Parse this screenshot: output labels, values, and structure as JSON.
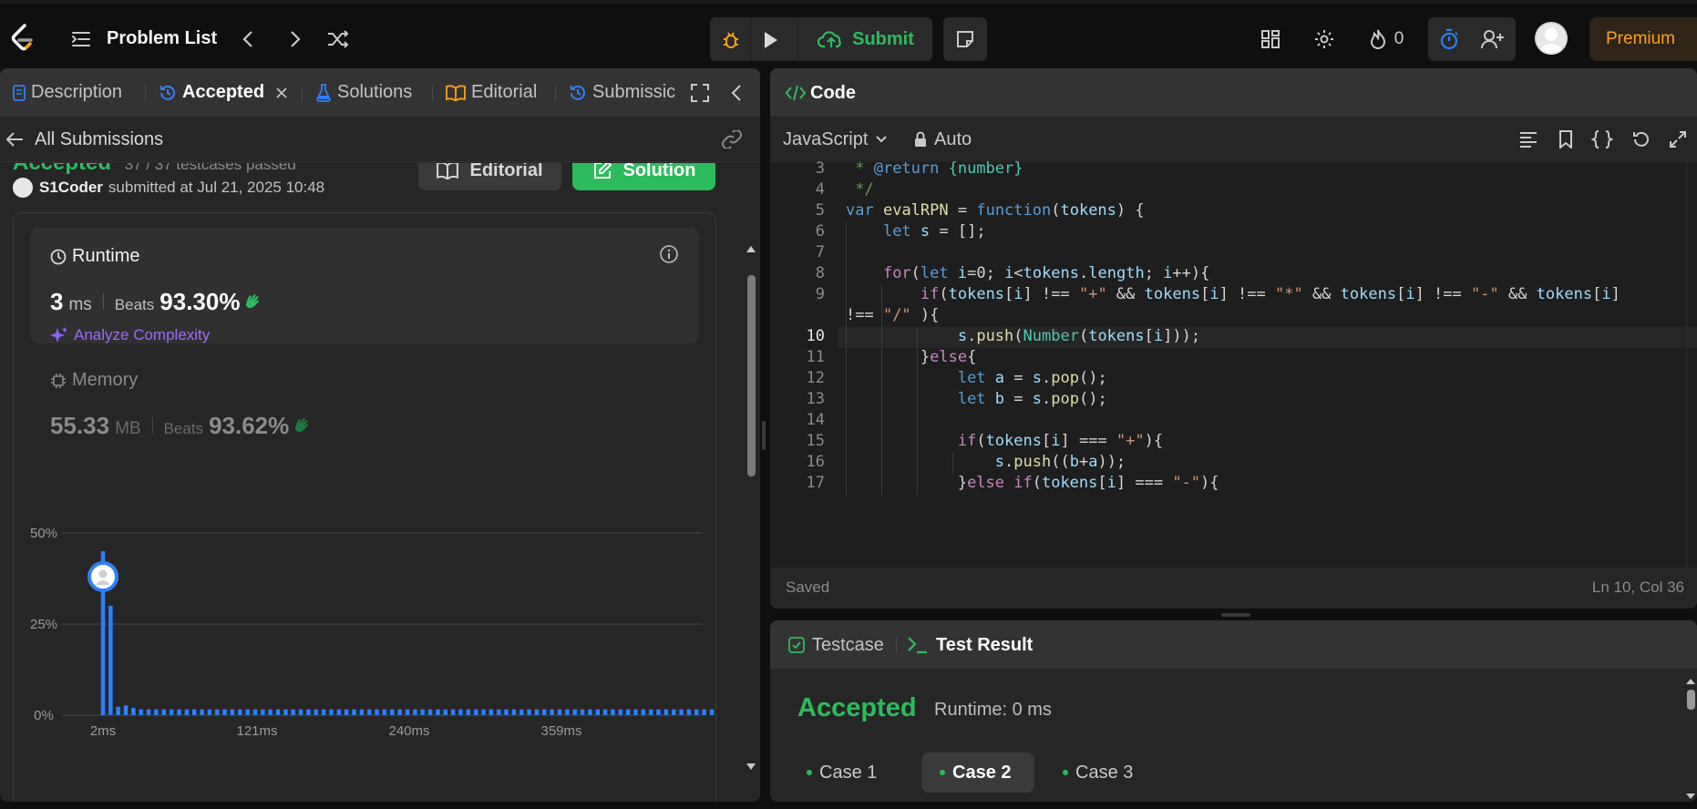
{
  "nav": {
    "title": "Problem List",
    "submit_label": "Submit",
    "streak_count": "0",
    "premium_label": "Premium"
  },
  "left_tabs": {
    "description": "Description",
    "accepted": "Accepted",
    "solutions": "Solutions",
    "editorial": "Editorial",
    "submissions": "Submissic"
  },
  "submission": {
    "back_label": "All Submissions",
    "status_partial": "Accepted",
    "testcases_partial": "37 / 37 testcases passed",
    "editorial_btn": "Editorial",
    "solution_btn": "Solution",
    "user": "S1Coder",
    "submitted_text": "submitted at Jul 21, 2025 10:48"
  },
  "runtime": {
    "label": "Runtime",
    "value": "3",
    "unit": "ms",
    "beats_label": "Beats",
    "beats_value": "93.30%",
    "analyze_label": "Analyze Complexity"
  },
  "memory": {
    "label": "Memory",
    "value": "55.33",
    "unit": "MB",
    "beats_label": "Beats",
    "beats_value": "93.62%"
  },
  "chart_data": {
    "type": "bar",
    "x_tick_labels": [
      "2ms",
      "121ms",
      "240ms",
      "359ms"
    ],
    "y_tick_labels": [
      "50%",
      "25%",
      "0%"
    ],
    "ylim": [
      0,
      50
    ],
    "values": [
      45,
      30,
      2.3,
      2.7,
      2,
      1.6,
      1.6,
      1.6,
      1.6,
      1.6,
      1.6,
      1.6,
      1.6,
      1.6,
      1.6,
      1.6,
      1.6,
      1.6,
      1.6,
      1.6,
      1.6,
      1.6,
      1.6,
      1.6,
      1.6,
      1.6,
      1.6,
      1.6,
      1.6,
      1.6,
      1.6,
      1.6,
      1.6,
      1.6,
      1.6,
      1.6,
      1.6,
      1.6,
      1.6,
      1.6,
      1.6,
      1.6,
      1.6,
      1.6,
      1.6,
      1.6,
      1.6,
      1.6,
      1.6,
      1.6,
      1.6,
      1.6,
      1.6,
      1.6,
      1.6,
      1.6,
      1.6,
      1.6,
      1.6,
      1.6,
      1.6,
      1.6,
      1.6,
      1.6,
      1.6,
      1.6,
      1.6,
      1.6,
      1.6,
      1.6,
      1.6,
      1.6,
      1.6,
      1.6,
      1.6,
      1.6,
      1.6,
      1.6,
      1.6,
      1.6,
      1.6,
      1.6,
      1.6,
      1.6,
      1.6,
      1.6,
      1.6,
      1.6,
      1.6,
      1.6
    ],
    "highlight_index": 0,
    "bar_color": "#2d7ff9"
  },
  "code_panel": {
    "title": "Code",
    "language": "JavaScript",
    "mode": "Auto",
    "saved_label": "Saved",
    "cursor_pos": "Ln 10, Col 36"
  },
  "code_lines": [
    {
      "n": "3",
      "text": " * @return {number}"
    },
    {
      "n": "4",
      "text": " */"
    },
    {
      "n": "5",
      "text": "var evalRPN = function(tokens) {"
    },
    {
      "n": "6",
      "text": "    let s = [];"
    },
    {
      "n": "7",
      "text": ""
    },
    {
      "n": "8",
      "text": "    for(let i=0; i<tokens.length; i++){"
    },
    {
      "n": "9",
      "text": "        if(tokens[i] !== \"+\" && tokens[i] !== \"*\" && tokens[i] !== \"-\" && tokens[i]"
    },
    {
      "n": "",
      "text": "!== \"/\" ){"
    },
    {
      "n": "10",
      "text": "            s.push(Number(tokens[i]));"
    },
    {
      "n": "11",
      "text": "        }else{"
    },
    {
      "n": "12",
      "text": "            let a = s.pop();"
    },
    {
      "n": "13",
      "text": "            let b = s.pop();"
    },
    {
      "n": "14",
      "text": ""
    },
    {
      "n": "15",
      "text": "            if(tokens[i] === \"+\"){"
    },
    {
      "n": "16",
      "text": "                s.push((b+a));"
    },
    {
      "n": "17",
      "text": "            }else if(tokens[i] === \"-\"){"
    }
  ],
  "test_panel": {
    "testcase_tab": "Testcase",
    "result_tab": "Test Result",
    "status": "Accepted",
    "runtime": "Runtime: 0 ms",
    "cases": [
      "Case 1",
      "Case 2",
      "Case 3"
    ]
  },
  "colors": {
    "accent_green": "#2cbb5d",
    "accent_orange": "#ffa116",
    "accent_blue": "#2d7ff9"
  }
}
